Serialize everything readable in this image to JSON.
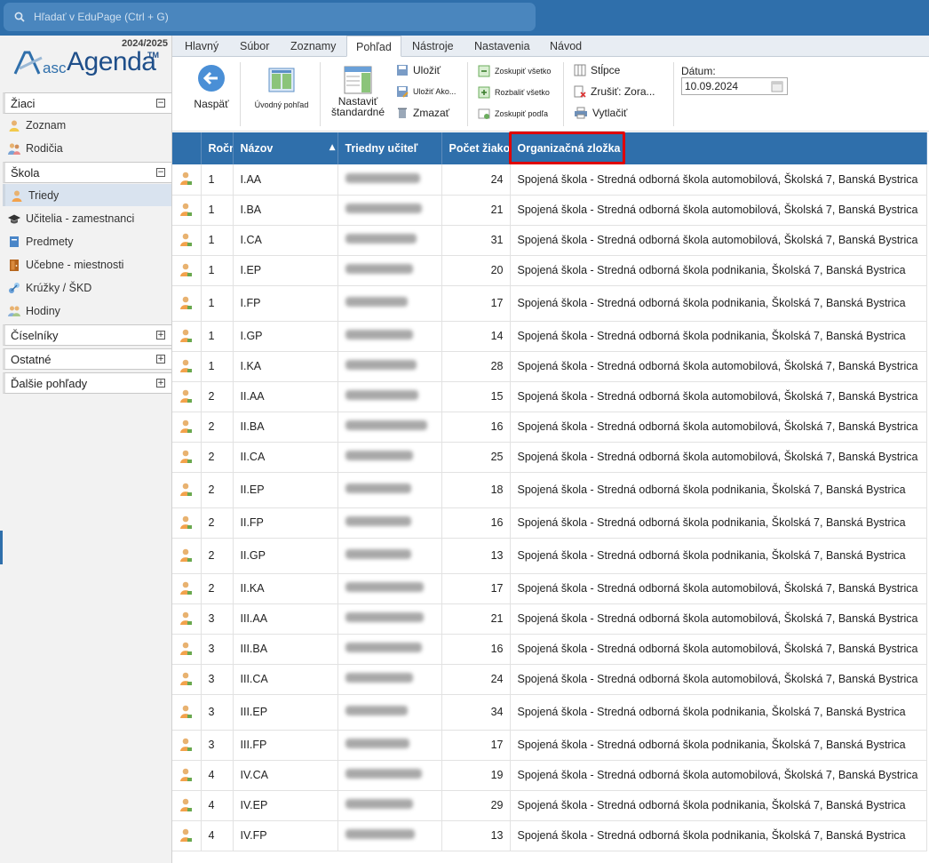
{
  "search": {
    "placeholder": "Hľadať v EduPage (Ctrl + G)"
  },
  "logo": {
    "year": "2024/2025",
    "asc": "asc",
    "name": "Agenda",
    "tm": "TM"
  },
  "sidebar": {
    "zaci": {
      "label": "Žiaci",
      "items": [
        "Zoznam",
        "Rodičia"
      ]
    },
    "skola": {
      "label": "Škola",
      "items": [
        "Triedy",
        "Učitelia - zamestnanci",
        "Predmety",
        "Učebne - miestnosti",
        "Krúžky / ŠKD",
        "Hodiny"
      ]
    },
    "ciselniky": "Číselníky",
    "ostatne": "Ostatné",
    "dalsie": "Ďalšie pohľady"
  },
  "menu": [
    "Hlavný",
    "Súbor",
    "Zoznamy",
    "Pohľad",
    "Nástroje",
    "Nastavenia",
    "Návod"
  ],
  "ribbon": {
    "naspat": "Naspäť",
    "uvodny": "Úvodný pohľad",
    "nastavit1": "Nastaviť",
    "nastavit2": "štandardné",
    "ulozit": "Uložiť",
    "ulozit_ako": "Uložiť Ako...",
    "zmazat": "Zmazať",
    "zoskupit_vsetko": "Zoskupiť všetko",
    "rozbalit_vsetko": "Rozbaliť všetko",
    "zoskupit_podla": "Zoskupiť podľa",
    "stlpce": "Stĺpce",
    "zrusit": "Zrušiť: Zora...",
    "vytlacit": "Vytlačiť",
    "datum_label": "Dátum:",
    "datum_value": "10.09.2024"
  },
  "table": {
    "headers": [
      "Ročník",
      "Názov",
      "Triedny učiteľ",
      "Počet žiakov",
      "Organizačná zložka"
    ],
    "org_auto": "Spojená škola - Stredná odborná škola automobilová, Školská 7, Banská Bystrica",
    "org_pod": "Spojená škola - Stredná odborná škola podnikania, Školská 7, Banská Bystrica",
    "rows": [
      {
        "r": "1",
        "n": "I.AA",
        "c": "24",
        "o": "Spojená škola - Stredná odborná škola automobilová, Školská 7, Banská Bystrica"
      },
      {
        "r": "1",
        "n": "I.BA",
        "c": "21",
        "o": "Spojená škola - Stredná odborná škola automobilová, Školská 7, Banská Bystrica"
      },
      {
        "r": "1",
        "n": "I.CA",
        "c": "31",
        "o": "Spojená škola - Stredná odborná škola automobilová, Školská 7, Banská Bystrica"
      },
      {
        "r": "1",
        "n": "I.EP",
        "c": "20",
        "o": "Spojená škola - Stredná odborná škola podnikania, Školská 7, Banská Bystrica"
      },
      {
        "r": "1",
        "n": "I.FP",
        "c": "17",
        "o": "Spojená škola - Stredná odborná škola podnikania, Školská 7, Banská Bystrica"
      },
      {
        "r": "1",
        "n": "I.GP",
        "c": "14",
        "o": "Spojená škola - Stredná odborná škola podnikania, Školská 7, Banská Bystrica"
      },
      {
        "r": "1",
        "n": "I.KA",
        "c": "28",
        "o": "Spojená škola - Stredná odborná škola automobilová, Školská 7, Banská Bystrica"
      },
      {
        "r": "2",
        "n": "II.AA",
        "c": "15",
        "o": "Spojená škola - Stredná odborná škola automobilová, Školská 7, Banská Bystrica"
      },
      {
        "r": "2",
        "n": "II.BA",
        "c": "16",
        "o": "Spojená škola - Stredná odborná škola automobilová, Školská 7, Banská Bystrica"
      },
      {
        "r": "2",
        "n": "II.CA",
        "c": "25",
        "o": "Spojená škola - Stredná odborná škola automobilová, Školská 7, Banská Bystrica"
      },
      {
        "r": "2",
        "n": "II.EP",
        "c": "18",
        "o": "Spojená škola - Stredná odborná škola podnikania, Školská 7, Banská Bystrica"
      },
      {
        "r": "2",
        "n": "II.FP",
        "c": "16",
        "o": "Spojená škola - Stredná odborná škola podnikania, Školská 7, Banská Bystrica"
      },
      {
        "r": "2",
        "n": "II.GP",
        "c": "13",
        "o": "Spojená škola - Stredná odborná škola podnikania, Školská 7, Banská Bystrica"
      },
      {
        "r": "2",
        "n": "II.KA",
        "c": "17",
        "o": "Spojená škola - Stredná odborná škola automobilová, Školská 7, Banská Bystrica"
      },
      {
        "r": "3",
        "n": "III.AA",
        "c": "21",
        "o": "Spojená škola - Stredná odborná škola automobilová, Školská 7, Banská Bystrica"
      },
      {
        "r": "3",
        "n": "III.BA",
        "c": "16",
        "o": "Spojená škola - Stredná odborná škola automobilová, Školská 7, Banská Bystrica"
      },
      {
        "r": "3",
        "n": "III.CA",
        "c": "24",
        "o": "Spojená škola - Stredná odborná škola automobilová, Školská 7, Banská Bystrica"
      },
      {
        "r": "3",
        "n": "III.EP",
        "c": "34",
        "o": "Spojená škola - Stredná odborná škola podnikania, Školská 7, Banská Bystrica"
      },
      {
        "r": "3",
        "n": "III.FP",
        "c": "17",
        "o": "Spojená škola - Stredná odborná škola podnikania, Školská 7, Banská Bystrica"
      },
      {
        "r": "4",
        "n": "IV.CA",
        "c": "19",
        "o": "Spojená škola - Stredná odborná škola automobilová, Školská 7, Banská Bystrica"
      },
      {
        "r": "4",
        "n": "IV.EP",
        "c": "29",
        "o": "Spojená škola - Stredná odborná škola podnikania, Školská 7, Banská Bystrica"
      },
      {
        "r": "4",
        "n": "IV.FP",
        "c": "13",
        "o": "Spojená škola - Stredná odborná škola podnikania, Školská 7, Banská Bystrica"
      }
    ]
  },
  "colors": {
    "accent": "#2f6fab",
    "highlight": "#e00000"
  }
}
